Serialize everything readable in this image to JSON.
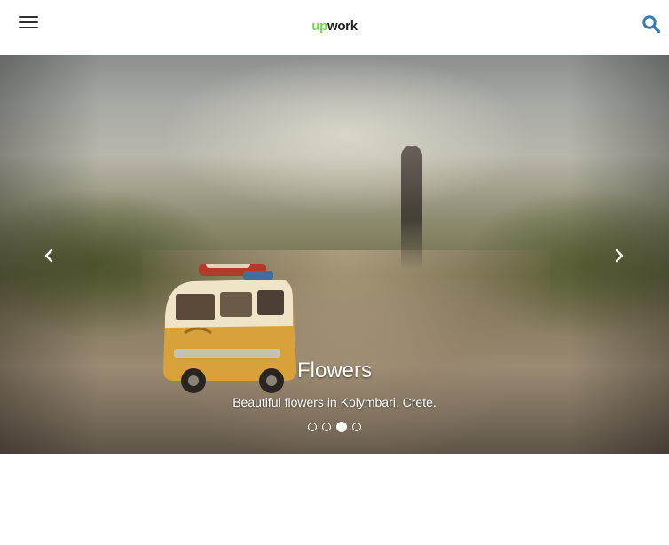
{
  "header": {
    "logo_up": "up",
    "logo_work": "work",
    "menu_icon": "hamburger-menu-icon",
    "search_icon": "search-icon",
    "accent_color": "#337ab7",
    "brand_color": "#6fda44"
  },
  "carousel": {
    "caption_title": "Flowers",
    "caption_text": "Beautiful flowers in Kolymbari, Crete.",
    "prev_label": "Previous",
    "next_label": "Next",
    "prev_icon": "chevron-left-icon",
    "next_icon": "chevron-right-icon",
    "slide_count": 4,
    "active_index": 2
  }
}
